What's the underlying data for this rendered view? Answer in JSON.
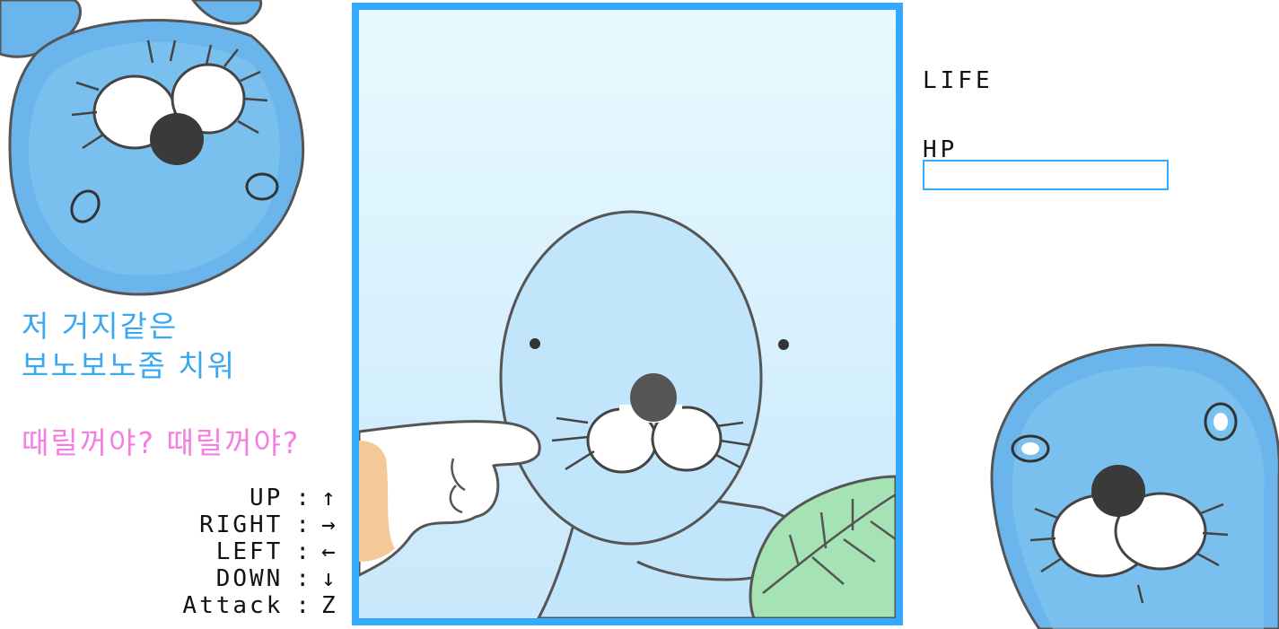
{
  "colors": {
    "accent": "#33a9ff",
    "message": "#3aa8f0",
    "taunt": "#f57ee0",
    "seal_body": "#bfe3fb",
    "seal_dark": "#6ab6ec",
    "sky_top": "#e8faff",
    "sky_bottom": "#c8e8fb",
    "leaf": "#a5e3b5"
  },
  "message": {
    "line1": "저 거지같은",
    "line2": "보노보노좀 치워"
  },
  "taunt": "때릴꺼야? 때릴꺼야?",
  "controls": [
    {
      "key": "UP",
      "sep": ":",
      "symbol": "↑"
    },
    {
      "key": "RIGHT",
      "sep": ":",
      "symbol": "→"
    },
    {
      "key": "LEFT",
      "sep": ":",
      "symbol": "←"
    },
    {
      "key": "DOWN",
      "sep": ":",
      "symbol": "↓"
    },
    {
      "key": "Attack",
      "sep": ":",
      "symbol": "Z"
    }
  ],
  "hud": {
    "life_label": "LIFE",
    "hp_label": "HP",
    "hp_fraction": 0
  },
  "icons": {
    "top_left_character": "bonobono-face-icon",
    "bottom_right_character": "bonobono-face-icon"
  }
}
